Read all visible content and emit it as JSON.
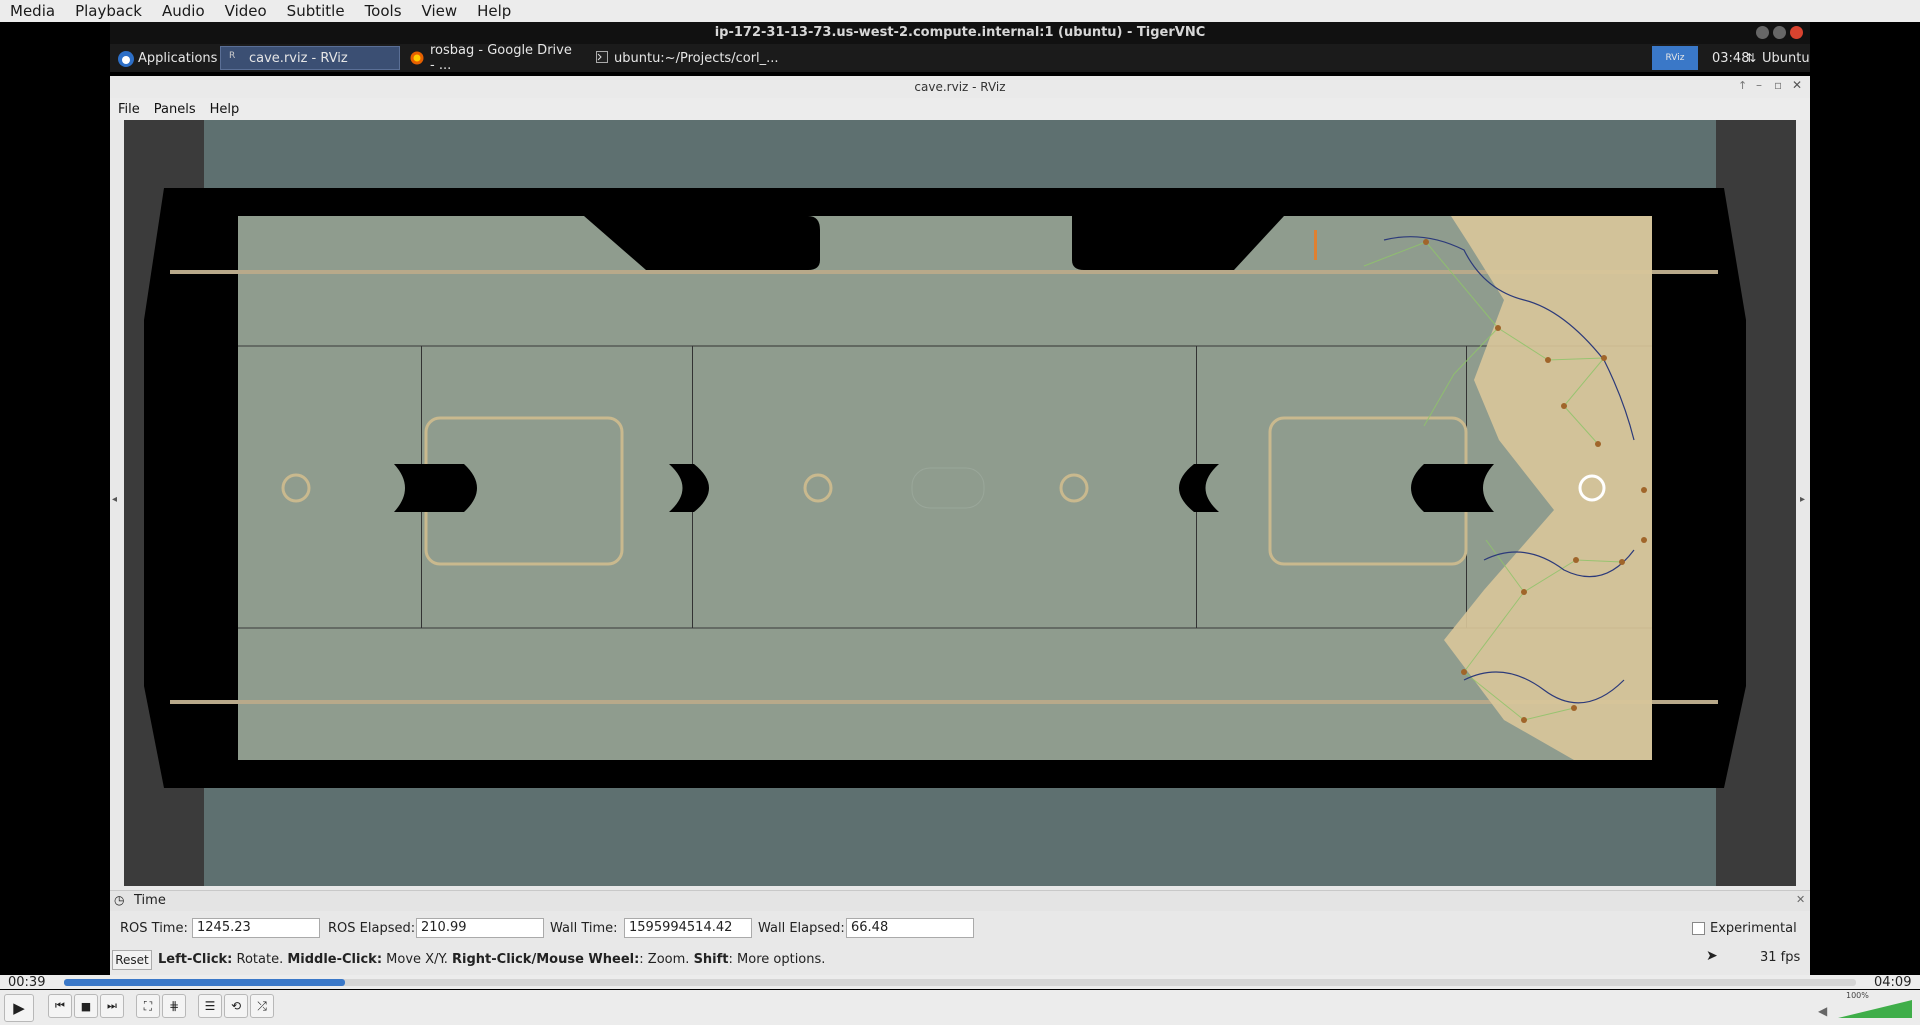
{
  "vlc": {
    "menu": [
      "Media",
      "Playback",
      "Audio",
      "Video",
      "Subtitle",
      "Tools",
      "View",
      "Help"
    ],
    "time_current": "00:39",
    "time_total": "04:09",
    "progress": 0.157,
    "volume_label": "100%",
    "volume": 1.0
  },
  "vnc": {
    "title": "ip-172-31-13-73.us-west-2.compute.internal:1 (ubuntu) - TigerVNC"
  },
  "panel": {
    "applications": "Applications",
    "tasks": [
      "cave.rviz - RViz",
      "rosbag - Google Drive - ...",
      "ubuntu:~/Projects/corl_..."
    ],
    "clock": "03:48",
    "user": "Ubuntu",
    "rviz_badge": "RViz"
  },
  "rviz": {
    "title": "cave.rviz - RViz",
    "menu": [
      "File",
      "Panels",
      "Help"
    ],
    "time_panel_title": "Time",
    "ros_time_label": "ROS Time:",
    "ros_time": "1245.23",
    "ros_elapsed_label": "ROS Elapsed:",
    "ros_elapsed": "210.99",
    "wall_time_label": "Wall Time:",
    "wall_time": "1595994514.42",
    "wall_elapsed_label": "Wall Elapsed:",
    "wall_elapsed": "66.48",
    "experimental": "Experimental",
    "reset": "Reset",
    "hint_left_click": "Left-Click:",
    "hint_rotate": " Rotate. ",
    "hint_middle_click": "Middle-Click:",
    "hint_move": " Move X/Y. ",
    "hint_right_click": "Right-Click/Mouse Wheel:",
    "hint_zoom": ": Zoom. ",
    "hint_shift": "Shift",
    "hint_more": ": More options.",
    "fps": "31 fps"
  },
  "colors": {
    "floor": "#8f9c8e",
    "sky": "#5e7070",
    "explored": "#d9c79a",
    "graph_edges": "#8fc46a",
    "nodes": "#a0652a",
    "path": "#2c3a7a",
    "accent": "#3a78c8"
  }
}
